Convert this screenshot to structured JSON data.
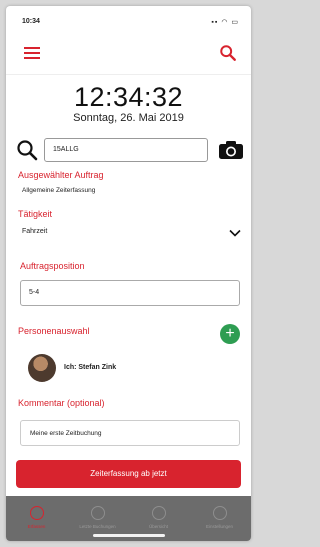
{
  "status_bar": {
    "time": "10:34",
    "icons": "▪▪ ◠ ▭"
  },
  "header": {
    "menu_icon": "hamburger-icon",
    "search_icon": "search-icon"
  },
  "clock": {
    "time": "12:34:32",
    "date": "Sonntag, 26. Mai 2019"
  },
  "scan": {
    "value": "15ALLG",
    "search_icon": "search-icon",
    "camera_icon": "camera-icon"
  },
  "selected_order": {
    "label": "Ausgewählter Auftrag",
    "value": "Allgemeine Zeiterfassung"
  },
  "activity": {
    "label": "Tätigkeit",
    "value": "Fahrzeit"
  },
  "order_position": {
    "label": "Auftragsposition",
    "value": "5-4"
  },
  "persons": {
    "label": "Personenauswahl",
    "add_icon": "plus-icon",
    "items": [
      {
        "name": "Ich: Stefan Zink"
      }
    ]
  },
  "comment": {
    "label": "Kommentar (optional)",
    "value": "Meine erste Zeitbuchung"
  },
  "primary_button": {
    "label": "Zeiterfassung ab jetzt"
  },
  "tabs": [
    {
      "label": "Erfassen",
      "active": true
    },
    {
      "label": "Letzte Buchungen",
      "active": false
    },
    {
      "label": "Übersicht",
      "active": false
    },
    {
      "label": "Einstellungen",
      "active": false
    }
  ],
  "colors": {
    "accent": "#d8232e",
    "add_green": "#2e9d52",
    "tabbar": "#6c6c6c"
  }
}
